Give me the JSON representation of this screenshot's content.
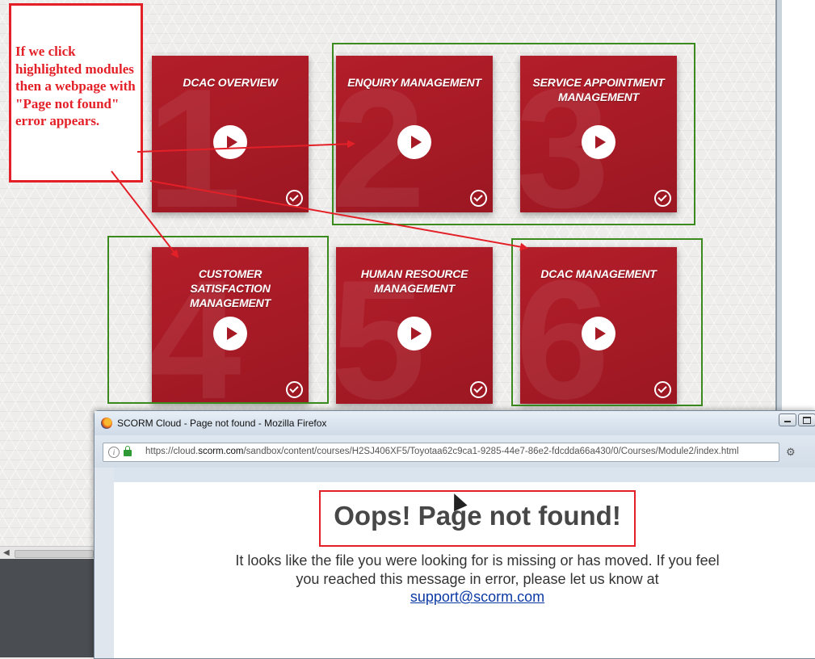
{
  "course": {
    "modules": [
      {
        "number": "1",
        "title": "DCAC OVERVIEW",
        "highlighted": false
      },
      {
        "number": "2",
        "title": "ENQUIRY MANAGEMENT",
        "highlighted": true
      },
      {
        "number": "3",
        "title": "SERVICE APPOINTMENT MANAGEMENT",
        "highlighted": true
      },
      {
        "number": "4",
        "title": "CUSTOMER SATISFACTION MANAGEMENT",
        "highlighted": true
      },
      {
        "number": "5",
        "title": "HUMAN RESOURCE MANAGEMENT",
        "highlighted": false
      },
      {
        "number": "6",
        "title": "DCAC MANAGEMENT",
        "highlighted": true
      }
    ],
    "accent_color": "#a51a25",
    "highlight_color": "#3a8a1e"
  },
  "annotation": {
    "text": "If we click highlighted modules then a webpage with \"Page not found\" error appears.",
    "color": "#e32027"
  },
  "firefox": {
    "window_title": "SCORM Cloud - Page not found - Mozilla Firefox",
    "url_prefix": "https://cloud.",
    "url_domain": "scorm.com",
    "url_path": "/sandbox/content/courses/H2SJ406XF5/Toyotaa62c9ca1-9285-44e7-86e2-fdcdda66a430/0/Courses/Module2/index.html",
    "page": {
      "heading": "Oops! Page not found!",
      "message": "It looks like the file you were looking for is missing or has moved. If you feel you reached this message in error, please let us know at",
      "link_text": "support@scorm.com"
    }
  }
}
